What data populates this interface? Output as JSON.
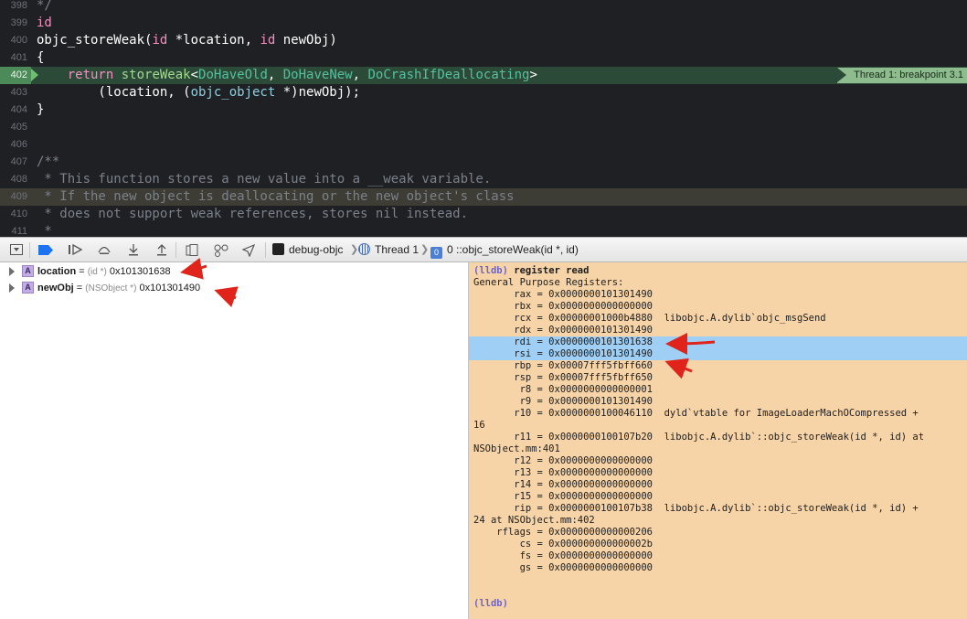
{
  "editor": {
    "lines": [
      {
        "num": "398",
        "tokens": [
          {
            "t": "*/",
            "c": "cm"
          }
        ]
      },
      {
        "num": "399",
        "tokens": [
          {
            "t": "id",
            "c": "kw"
          }
        ]
      },
      {
        "num": "400",
        "tokens": [
          {
            "t": "objc_storeWeak(",
            "c": ""
          },
          {
            "t": "id",
            "c": "kw"
          },
          {
            "t": " *location, ",
            "c": ""
          },
          {
            "t": "id",
            "c": "kw"
          },
          {
            "t": " newObj)",
            "c": ""
          }
        ]
      },
      {
        "num": "401",
        "tokens": [
          {
            "t": "{",
            "c": ""
          }
        ]
      },
      {
        "num": "402",
        "hl": "green",
        "breakpoint": true,
        "tokens": [
          {
            "t": "    ",
            "c": ""
          },
          {
            "t": "return",
            "c": "kw"
          },
          {
            "t": " ",
            "c": ""
          },
          {
            "t": "storeWeak",
            "c": "fn"
          },
          {
            "t": "<",
            "c": ""
          },
          {
            "t": "DoHaveOld",
            "c": "tmp"
          },
          {
            "t": ", ",
            "c": ""
          },
          {
            "t": "DoHaveNew",
            "c": "tmp"
          },
          {
            "t": ", ",
            "c": ""
          },
          {
            "t": "DoCrashIfDeallocating",
            "c": "tmp"
          },
          {
            "t": ">",
            "c": ""
          }
        ]
      },
      {
        "num": "403",
        "tokens": [
          {
            "t": "        (location, (",
            "c": ""
          },
          {
            "t": "objc_object",
            "c": "ty"
          },
          {
            "t": " *)newObj);",
            "c": ""
          }
        ]
      },
      {
        "num": "404",
        "tokens": [
          {
            "t": "}",
            "c": ""
          }
        ]
      },
      {
        "num": "405",
        "tokens": []
      },
      {
        "num": "406",
        "tokens": []
      },
      {
        "num": "407",
        "tokens": [
          {
            "t": "/**",
            "c": "cm"
          }
        ]
      },
      {
        "num": "408",
        "tokens": [
          {
            "t": " * This function stores a new value into a __weak variable.",
            "c": "cm"
          }
        ]
      },
      {
        "num": "409",
        "hl": "grey",
        "tokens": [
          {
            "t": " * If the new object is deallocating or the new object's class",
            "c": "cm"
          }
        ]
      },
      {
        "num": "410",
        "tokens": [
          {
            "t": " * does not support weak references, stores nil instead.",
            "c": "cm"
          }
        ]
      },
      {
        "num": "411",
        "tokens": [
          {
            "t": " *",
            "c": "cm"
          }
        ]
      }
    ],
    "breakpoint_label": "Thread 1: breakpoint 3.1"
  },
  "debug_bar": {
    "target": "debug-objc",
    "thread": "Thread 1",
    "frame": "0 ::objc_storeWeak(id *, id)",
    "frame_badge": "0"
  },
  "variables": [
    {
      "badge": "A",
      "name": "location",
      "type": "(id *)",
      "value": "0x101301638"
    },
    {
      "badge": "A",
      "name": "newObj",
      "type": "(NSObject *)",
      "value": "0x101301490"
    }
  ],
  "console": {
    "lines": [
      {
        "prompt": "(lldb)",
        "text": " register read",
        "cmd": true
      },
      {
        "text": "General Purpose Registers:"
      },
      {
        "text": "       rax = 0x0000000101301490"
      },
      {
        "text": "       rbx = 0x0000000000000000"
      },
      {
        "text": "       rcx = 0x00000001000b4880  libobjc.A.dylib`objc_msgSend"
      },
      {
        "text": "       rdx = 0x0000000101301490"
      },
      {
        "text": "       rdi = 0x0000000101301638",
        "sel": true
      },
      {
        "text": "       rsi = 0x0000000101301490",
        "sel": true
      },
      {
        "text": "       rbp = 0x00007fff5fbff660"
      },
      {
        "text": "       rsp = 0x00007fff5fbff650"
      },
      {
        "text": "        r8 = 0x0000000000000001"
      },
      {
        "text": "        r9 = 0x0000000101301490"
      },
      {
        "text": "       r10 = 0x0000000100046110  dyld`vtable for ImageLoaderMachOCompressed +"
      },
      {
        "text": "16"
      },
      {
        "text": "       r11 = 0x0000000100107b20  libobjc.A.dylib`::objc_storeWeak(id *, id) at"
      },
      {
        "text": "NSObject.mm:401"
      },
      {
        "text": "       r12 = 0x0000000000000000"
      },
      {
        "text": "       r13 = 0x0000000000000000"
      },
      {
        "text": "       r14 = 0x0000000000000000"
      },
      {
        "text": "       r15 = 0x0000000000000000"
      },
      {
        "text": "       rip = 0x0000000100107b38  libobjc.A.dylib`::objc_storeWeak(id *, id) +"
      },
      {
        "text": "24 at NSObject.mm:402"
      },
      {
        "text": "    rflags = 0x0000000000000206"
      },
      {
        "text": "        cs = 0x000000000000002b"
      },
      {
        "text": "        fs = 0x0000000000000000"
      },
      {
        "text": "        gs = 0x0000000000000000"
      },
      {
        "text": ""
      },
      {
        "text": ""
      },
      {
        "prompt": "(lldb)",
        "text": ""
      }
    ]
  },
  "colors": {
    "annotation_arrow": "#e0241c",
    "console_bg": "#f7d4a8",
    "selection": "#9fcff5",
    "breakpoint_line": "#2b4a38"
  }
}
